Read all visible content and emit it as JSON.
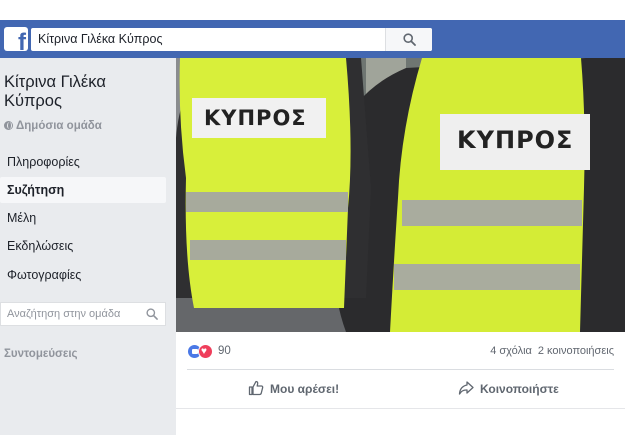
{
  "header": {
    "logo_letter": "f",
    "search_value": "Κίτρινα Γιλέκα Κύπρος"
  },
  "sidebar": {
    "group_title": "Κίτρινα Γιλέκα Κύπρος",
    "group_type": "Δημόσια ομάδα",
    "nav_items": [
      {
        "label": "Πληροφορίες"
      },
      {
        "label": "Συζήτηση"
      },
      {
        "label": "Μέλη"
      },
      {
        "label": "Εκδηλώσεις"
      },
      {
        "label": "Φωτογραφίες"
      }
    ],
    "active_index": 1,
    "group_search_placeholder": "Αναζήτηση στην ομάδα",
    "shortcuts_label": "Συντομεύσεις"
  },
  "cover": {
    "vest_left_text": "ΚΥΠΡΟΣ",
    "vest_right_text": "ΚΥΠΡΟΣ",
    "vest_color": "#d8ef3a"
  },
  "post": {
    "reaction_count": "90",
    "comments": "4 σχόλια",
    "shares": "2 κοινοποιήσεις",
    "like_label": "Μου αρέσει!",
    "share_label": "Κοινοποιήστε"
  },
  "colors": {
    "brand": "#4267b2",
    "sidebar_bg": "#e9ebee",
    "like_blue": "#4a78e6",
    "love_red": "#ef3e5b"
  }
}
